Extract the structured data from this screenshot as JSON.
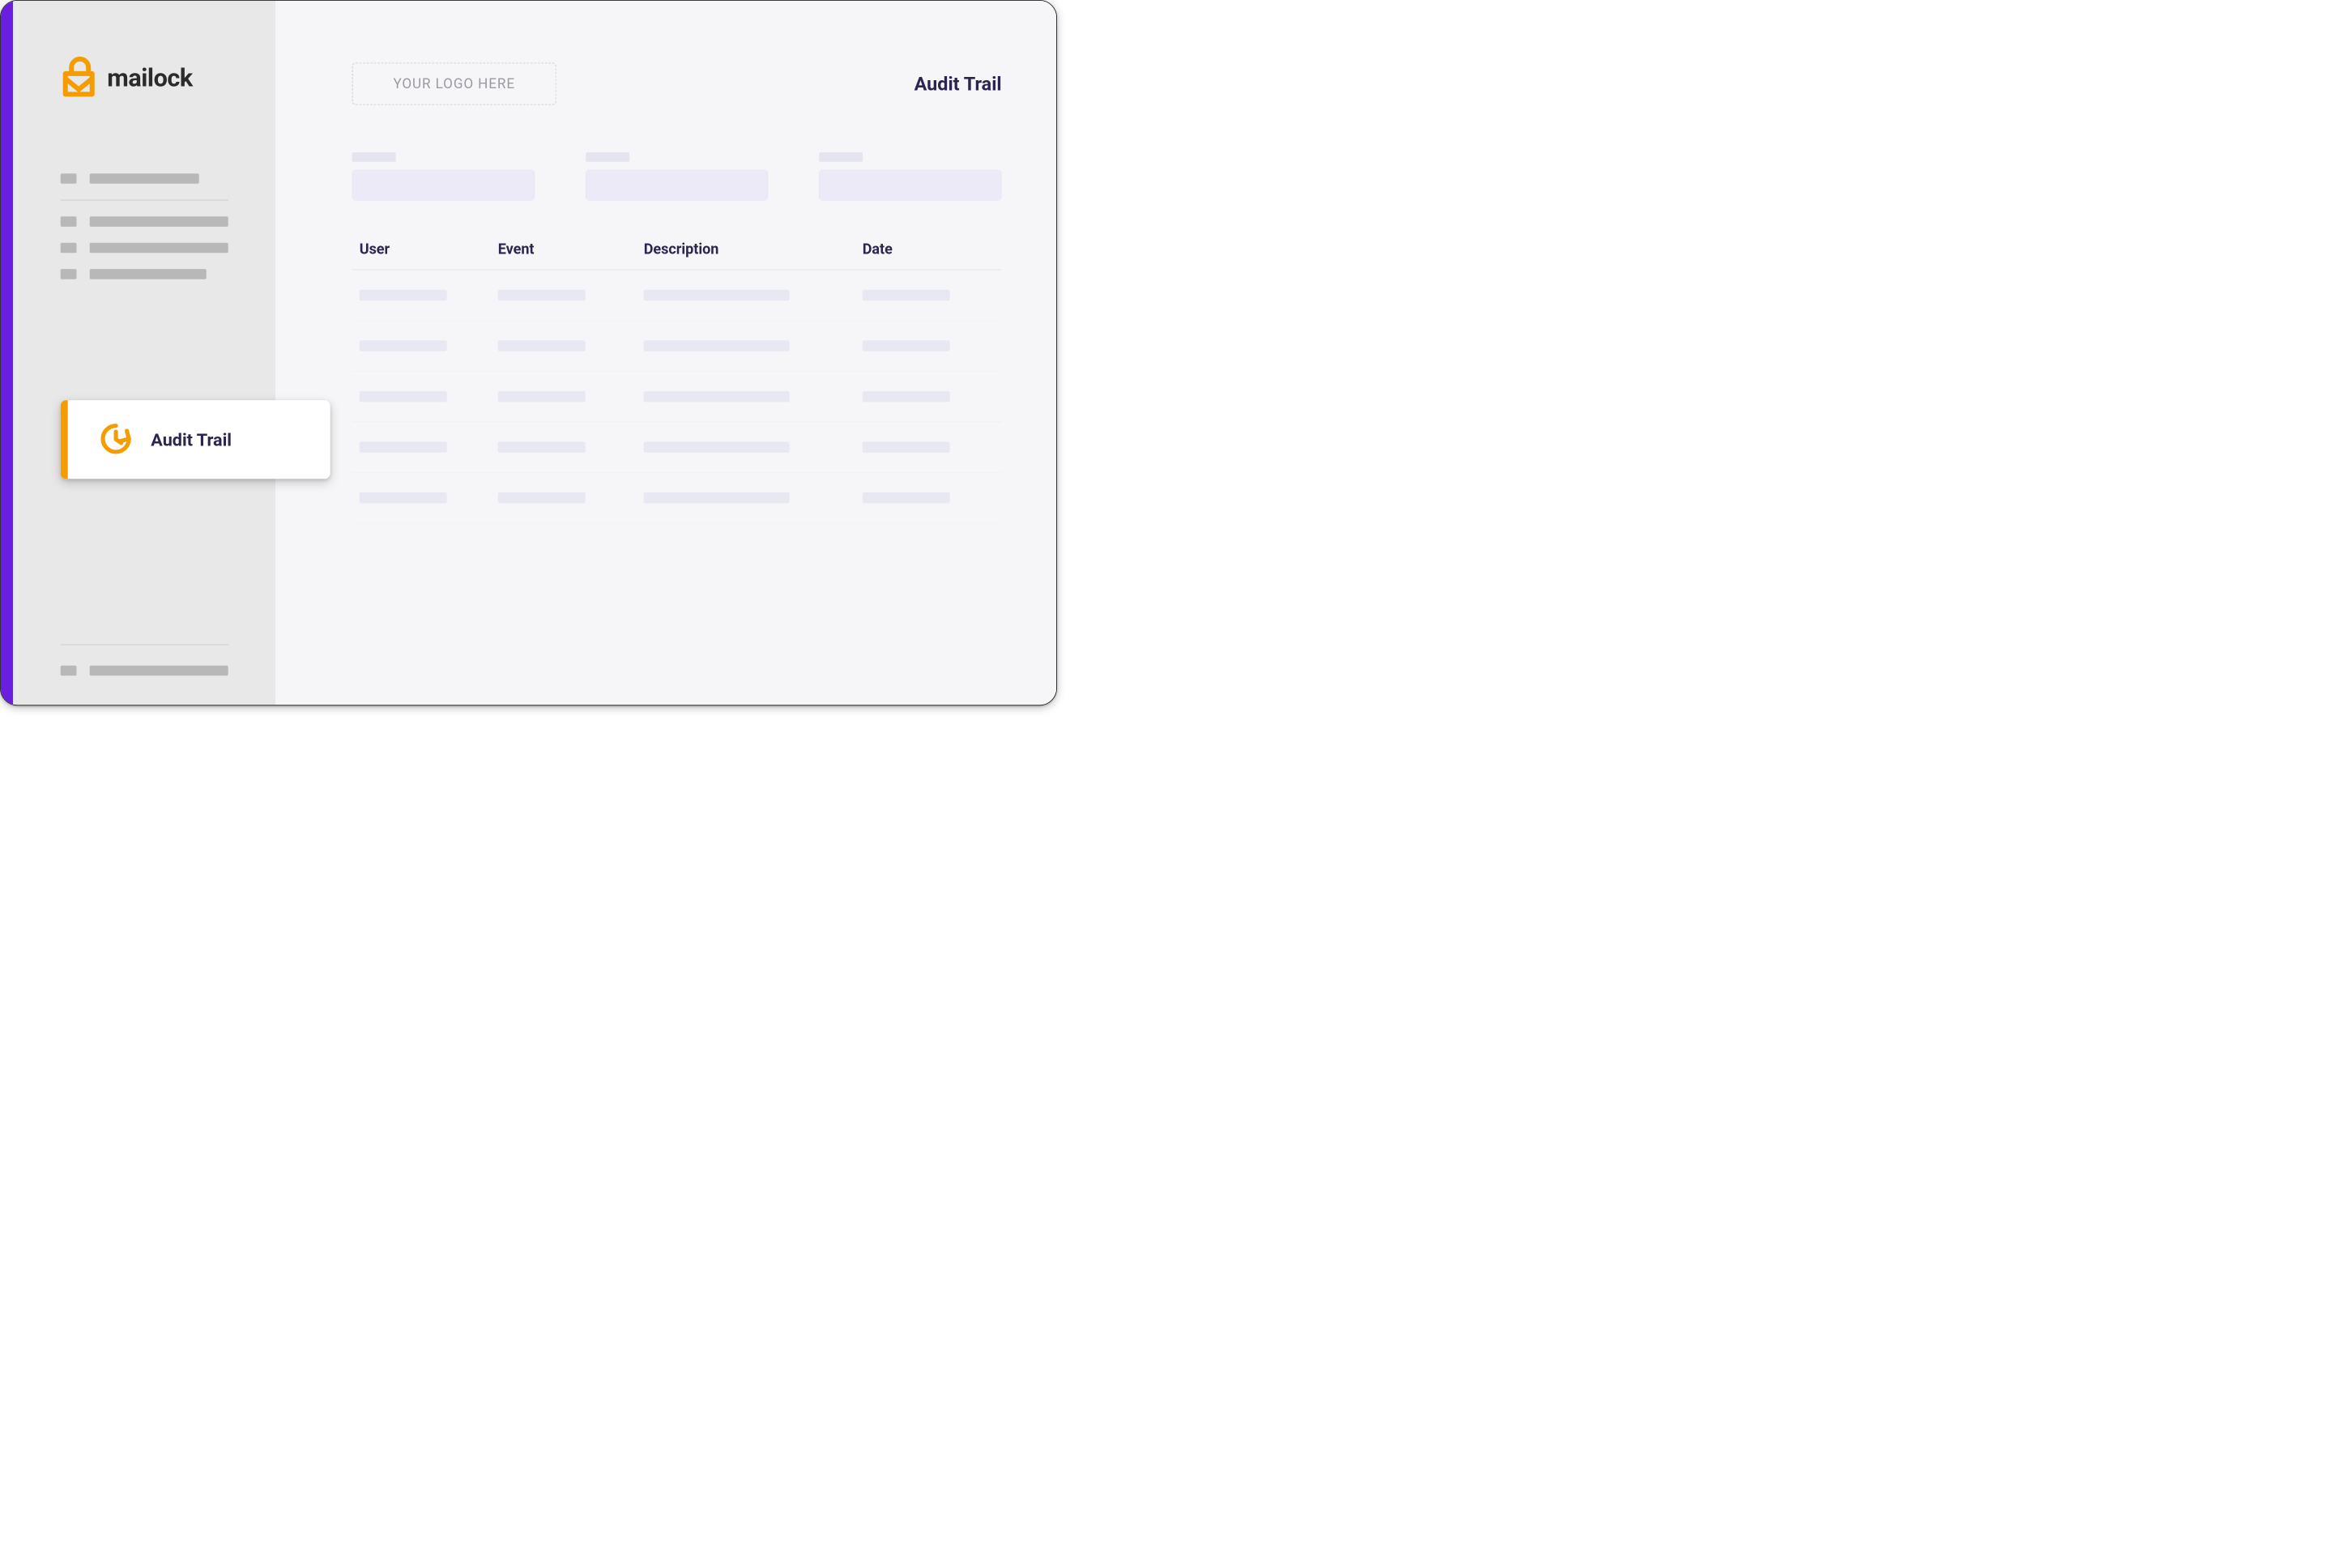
{
  "colors": {
    "accent": "#6a1fe0",
    "brandOrange": "#f59c00",
    "heading": "#2b2550"
  },
  "brand": {
    "name": "mailock"
  },
  "sidebar": {
    "activeItem": {
      "label": "Audit Trail"
    }
  },
  "header": {
    "logoPlaceholder": "YOUR LOGO HERE",
    "pageTitle": "Audit Trail"
  },
  "table": {
    "columns": [
      "User",
      "Event",
      "Description",
      "Date"
    ],
    "rowCount": 5
  }
}
